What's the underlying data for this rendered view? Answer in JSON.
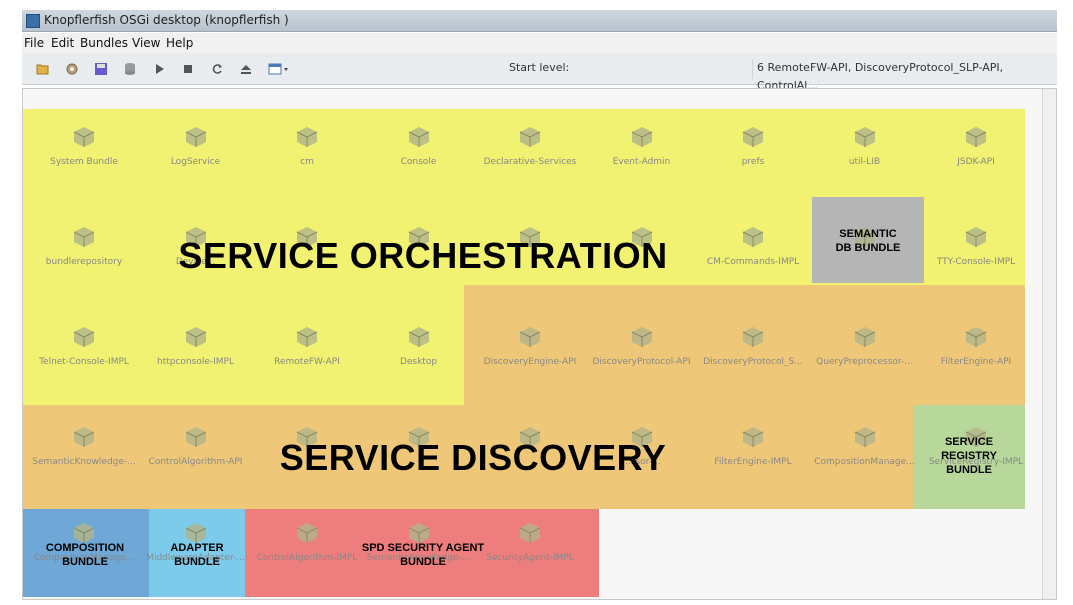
{
  "window": {
    "title": "Knopflerfish OSGi desktop (knopflerfish )"
  },
  "menu": [
    "File",
    "Edit",
    "Bundles",
    "View",
    "Help"
  ],
  "toolbar": {
    "start_level_label": "Start level:",
    "start_level_value": "6 RemoteFW-API, DiscoveryProtocol_SLP-API, ControlAl..."
  },
  "bundles": [
    "System Bundle",
    "LogService",
    "cm",
    "Console",
    "Declarative-Services",
    "Event-Admin",
    "prefs",
    "util-LIB",
    "JSDK-API",
    "bundlerepository",
    "Device...",
    "",
    "",
    "",
    "",
    "CM-Commands-IMPL",
    "",
    "TTY-Console-IMPL",
    "Telnet-Console-IMPL",
    "httpconsole-IMPL",
    "RemoteFW-API",
    "Desktop",
    "DiscoveryEngine-API",
    "DiscoveryProtocol-API",
    "DiscoveryProtocol_S...",
    "QueryPreprocessor-...",
    "FilterEngine-API",
    "SemanticKnowledge-...",
    "ControlAlgorithm-API",
    "",
    "",
    "",
    "...ssor-...",
    "FilterEngine-IMPL",
    "CompositionManage...",
    "ServiceRegistry-IMPL",
    "CompositionManage...",
    "MiddlewareAdapter-...",
    "ControlAlgorithm-IMPL",
    "SemanticKnowledge-...",
    "SecurityAgent-IMPL"
  ],
  "overlays": {
    "orchestration": "SERVICE ORCHESTRATION",
    "discovery": "SERVICE DISCOVERY",
    "semantic_db": "SEMANTIC DB BUNDLE",
    "registry": "SERVICE REGISTRY BUNDLE",
    "composition": "COMPOSITION BUNDLE",
    "adapter": "ADAPTER BUNDLE",
    "spd": "SPD SECURITY AGENT BUNDLE"
  },
  "colors": {
    "orchestration": "#f0f06a",
    "discovery": "#eec878",
    "semantic_db": "#b5b5b5",
    "registry": "#b7d89a",
    "composition": "#6fa8d6",
    "adapter": "#7dcbea",
    "spd": "#ee7d7d"
  }
}
